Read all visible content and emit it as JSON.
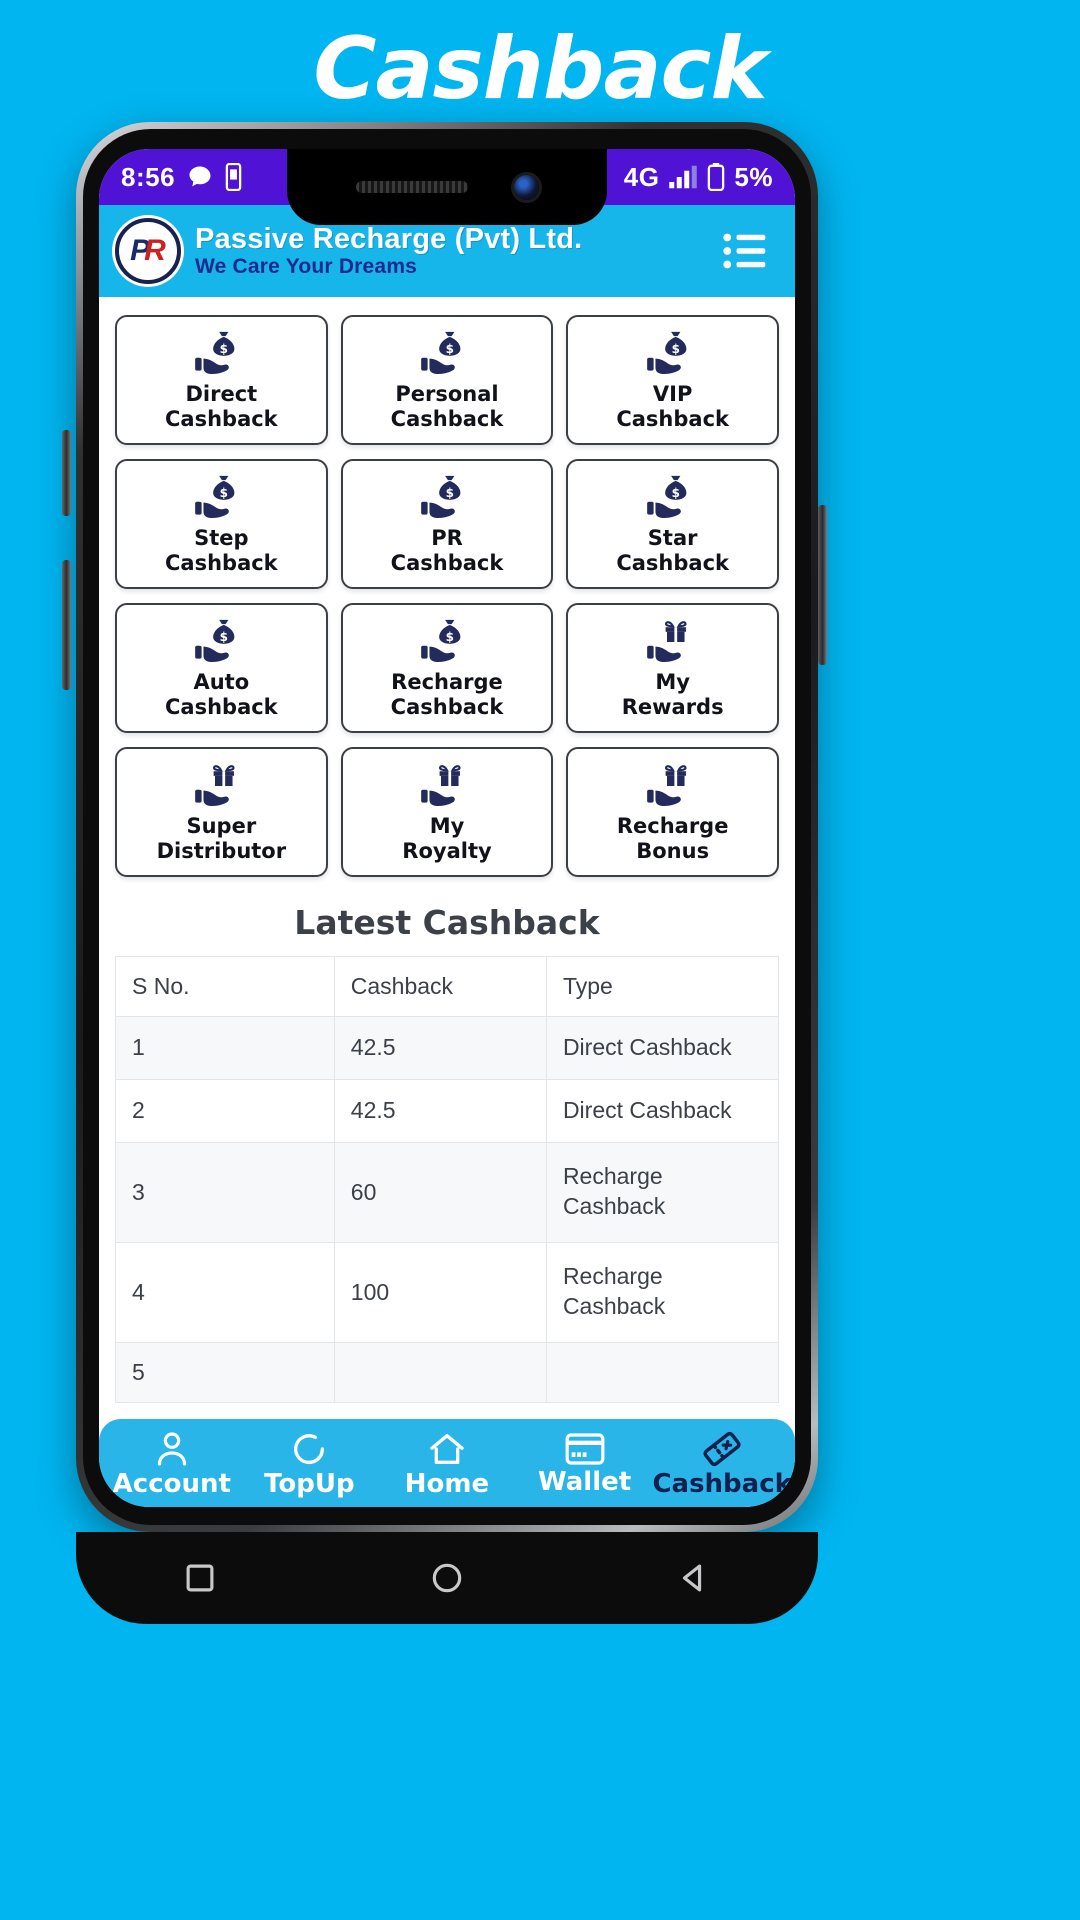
{
  "banner": {
    "title": "Cashback"
  },
  "status_bar": {
    "time": "8:56",
    "message_icon": "chat-bubble-icon",
    "sim_icon": "sim-card-icon",
    "network": "4G",
    "signal_icon": "signal-bars-icon",
    "battery_icon": "battery-icon",
    "battery_percent": "5%",
    "background_color": "#5013d6"
  },
  "app_bar": {
    "logo_text_p": "P",
    "logo_text_r": "R",
    "title": "Passive Recharge (Pvt) Ltd.",
    "subtitle": "We Care Your Dreams",
    "menu_icon": "list-menu-icon",
    "background_color": "#16b6ea"
  },
  "grid": {
    "tiles": [
      {
        "line1": "Direct",
        "line2": "Cashback",
        "icon": "hand-money-bag-icon"
      },
      {
        "line1": "Personal",
        "line2": "Cashback",
        "icon": "hand-money-bag-icon"
      },
      {
        "line1": "VIP",
        "line2": "Cashback",
        "icon": "hand-money-bag-icon"
      },
      {
        "line1": "Step",
        "line2": "Cashback",
        "icon": "hand-money-bag-icon"
      },
      {
        "line1": "PR",
        "line2": "Cashback",
        "icon": "hand-money-bag-icon"
      },
      {
        "line1": "Star",
        "line2": "Cashback",
        "icon": "hand-money-bag-icon"
      },
      {
        "line1": "Auto",
        "line2": "Cashback",
        "icon": "hand-money-bag-icon"
      },
      {
        "line1": "Recharge",
        "line2": "Cashback",
        "icon": "hand-money-bag-icon"
      },
      {
        "line1": "My",
        "line2": "Rewards",
        "icon": "hand-gift-box-icon"
      },
      {
        "line1": "Super",
        "line2": "Distributor",
        "icon": "hand-gift-box-icon"
      },
      {
        "line1": "My",
        "line2": "Royalty",
        "icon": "hand-gift-box-icon"
      },
      {
        "line1": "Recharge",
        "line2": "Bonus",
        "icon": "hand-gift-box-icon"
      }
    ]
  },
  "latest_cashback": {
    "title": "Latest Cashback",
    "columns": [
      "S No.",
      "Cashback",
      "Type"
    ],
    "rows": [
      {
        "sno": "1",
        "cashback": "42.5",
        "type": "Direct Cashback"
      },
      {
        "sno": "2",
        "cashback": "42.5",
        "type": "Direct Cashback"
      },
      {
        "sno": "3",
        "cashback": "60",
        "type": "Recharge Cashback"
      },
      {
        "sno": "4",
        "cashback": "100",
        "type": "Recharge Cashback"
      },
      {
        "sno": "5",
        "cashback": "",
        "type": ""
      }
    ]
  },
  "bottom_nav": {
    "items": [
      {
        "label": "Account",
        "icon": "person-icon",
        "active": false
      },
      {
        "label": "TopUp",
        "icon": "refresh-circle-icon",
        "active": false
      },
      {
        "label": "Home",
        "icon": "home-icon",
        "active": false
      },
      {
        "label": "Wallet",
        "icon": "credit-card-icon",
        "active": false
      },
      {
        "label": "Cashback",
        "icon": "ticket-icon",
        "active": true
      }
    ],
    "background_color": "#2ab5e8",
    "active_color": "#10204f"
  },
  "android_nav": {
    "recent_icon": "square-recents-icon",
    "home_icon": "circle-home-icon",
    "back_icon": "triangle-back-icon"
  }
}
